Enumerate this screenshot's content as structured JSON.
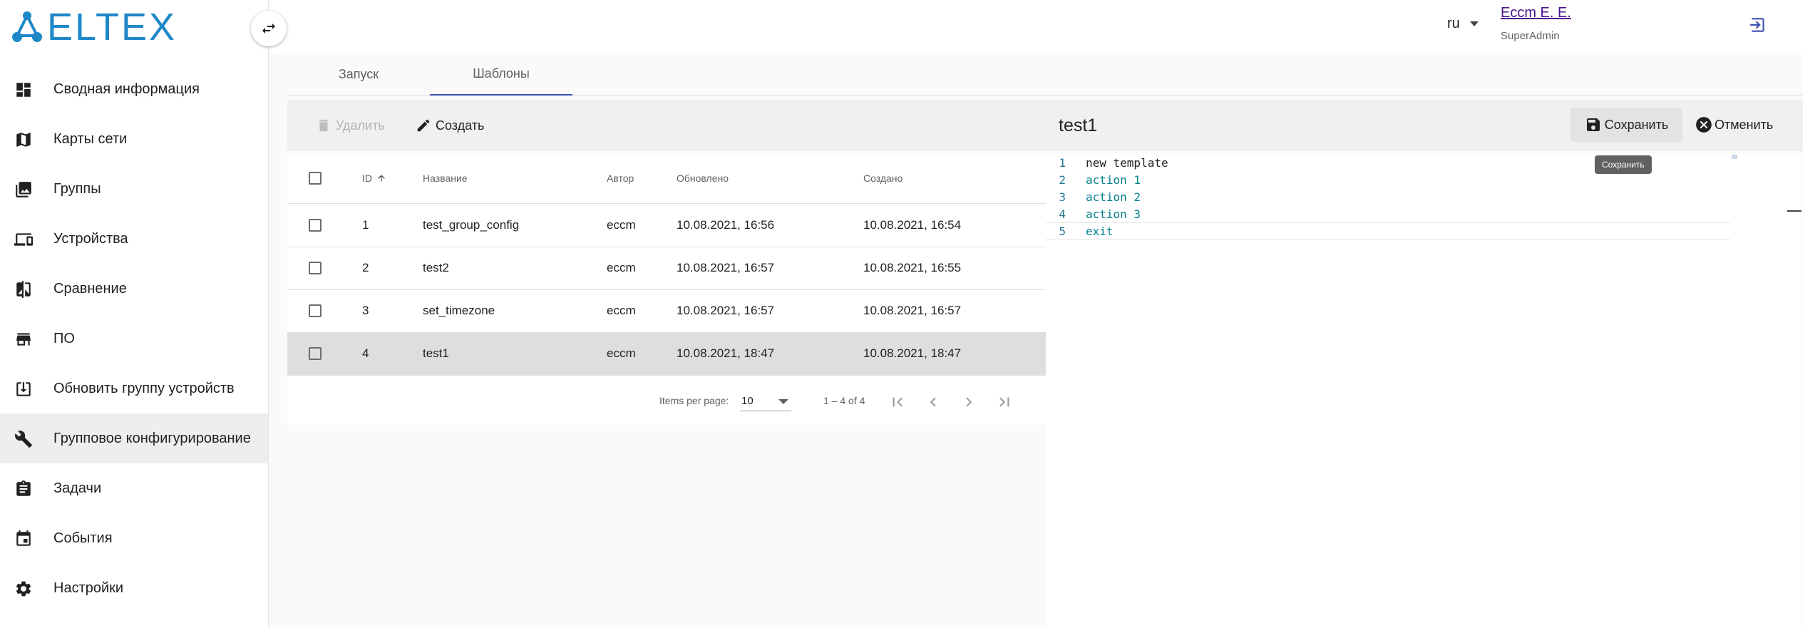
{
  "brand": {
    "name": "ELTEX",
    "color": "#1e88c8"
  },
  "sidebar": {
    "toggle_icon": "swap-horizontal-icon",
    "items": [
      {
        "label": "Сводная информация",
        "icon": "dashboard-icon",
        "active": false
      },
      {
        "label": "Карты сети",
        "icon": "map-icon",
        "active": false
      },
      {
        "label": "Группы",
        "icon": "photo-library-icon",
        "active": false
      },
      {
        "label": "Устройства",
        "icon": "devices-icon",
        "active": false
      },
      {
        "label": "Сравнение",
        "icon": "compare-icon",
        "active": false
      },
      {
        "label": "ПО",
        "icon": "store-icon",
        "active": false
      },
      {
        "label": "Обновить группу устройств",
        "icon": "download-box-icon",
        "active": false
      },
      {
        "label": "Групповое конфигурирование",
        "icon": "wrench-icon",
        "active": true
      },
      {
        "label": "Задачи",
        "icon": "clipboard-icon",
        "active": false
      },
      {
        "label": "События",
        "icon": "calendar-icon",
        "active": false
      },
      {
        "label": "Настройки",
        "icon": "gear-icon",
        "active": false
      }
    ]
  },
  "header": {
    "language": "ru",
    "user_name": "Eccm E. E.",
    "user_role": "SuperAdmin",
    "logout_icon": "logout-icon"
  },
  "tabs": [
    {
      "label": "Запуск",
      "active": false
    },
    {
      "label": "Шаблоны",
      "active": true
    }
  ],
  "toolbar": {
    "delete_label": "Удалить",
    "create_label": "Создать",
    "editor_title": "test1",
    "save_label": "Сохранить",
    "cancel_label": "Отменить",
    "save_tooltip": "Сохранить"
  },
  "table": {
    "columns": {
      "id": "ID",
      "name": "Название",
      "author": "Автор",
      "updated": "Обновлено",
      "created": "Создано"
    },
    "sort": {
      "column": "id",
      "direction": "asc"
    },
    "rows": [
      {
        "id": "1",
        "name": "test_group_config",
        "author": "eccm",
        "updated": "10.08.2021, 16:56",
        "created": "10.08.2021, 16:54",
        "selected": false
      },
      {
        "id": "2",
        "name": "test2",
        "author": "eccm",
        "updated": "10.08.2021, 16:57",
        "created": "10.08.2021, 16:55",
        "selected": false
      },
      {
        "id": "3",
        "name": "set_timezone",
        "author": "eccm",
        "updated": "10.08.2021, 16:57",
        "created": "10.08.2021, 16:57",
        "selected": false
      },
      {
        "id": "4",
        "name": "test1",
        "author": "eccm",
        "updated": "10.08.2021, 18:47",
        "created": "10.08.2021, 18:47",
        "selected": true
      }
    ]
  },
  "paginator": {
    "items_per_page_label": "Items per page:",
    "page_size": "10",
    "range": "1 – 4 of 4"
  },
  "editor": {
    "lines": [
      {
        "num": "1",
        "text": "new template"
      },
      {
        "num": "2",
        "text": "action 1"
      },
      {
        "num": "3",
        "text": "action 2"
      },
      {
        "num": "4",
        "text": "action 3"
      },
      {
        "num": "5",
        "text": "exit"
      }
    ]
  },
  "colors": {
    "accent": "#3f51b5",
    "user_link": "#4a148c",
    "selected_row": "#dedede"
  }
}
